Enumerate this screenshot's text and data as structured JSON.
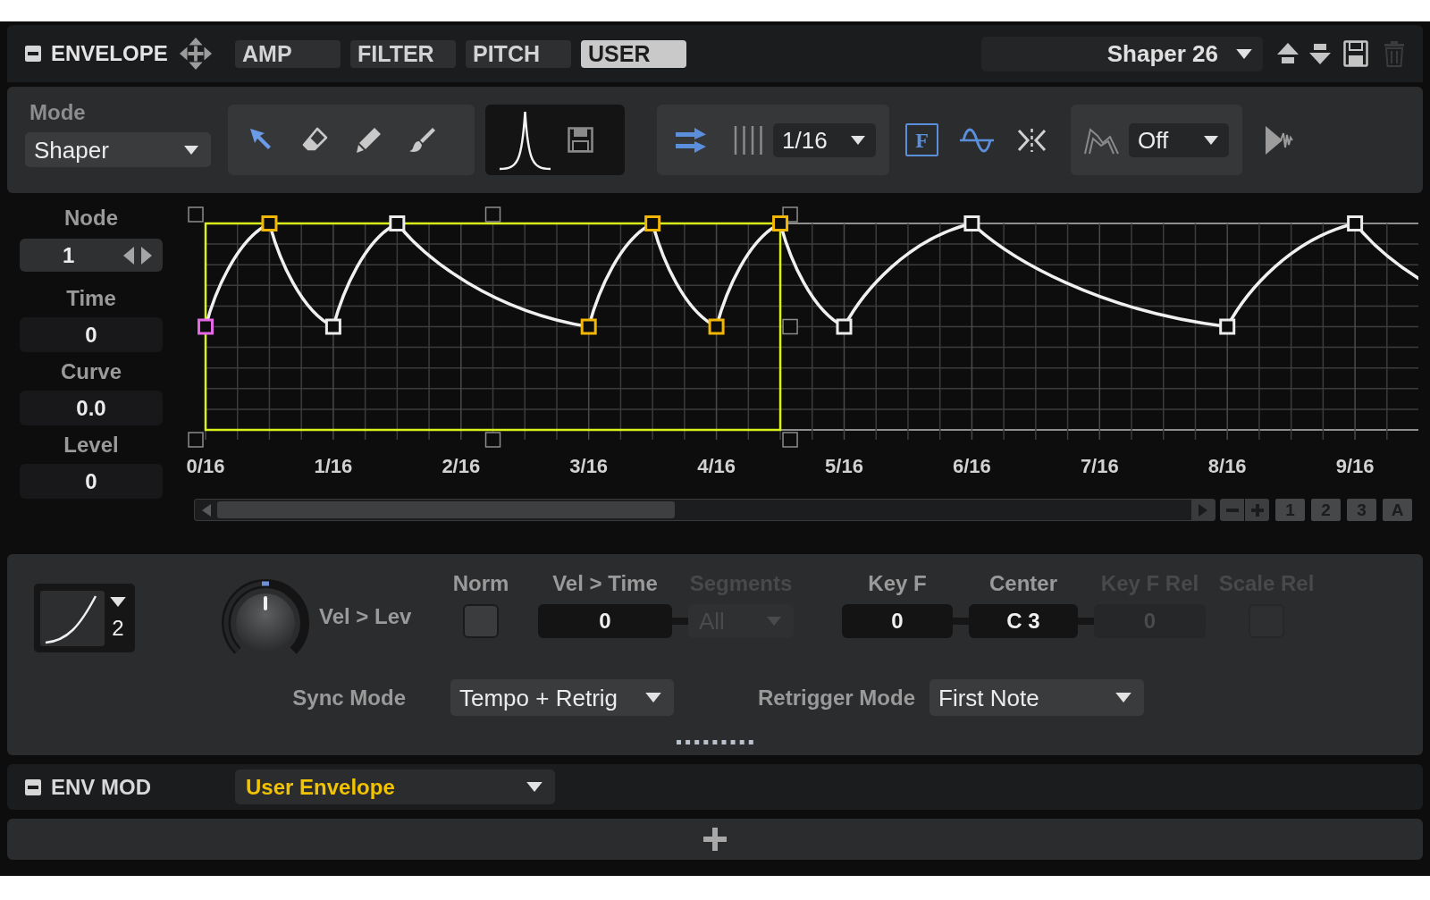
{
  "header": {
    "title": "ENVELOPE",
    "tabs": [
      {
        "label": "AMP",
        "selected": false
      },
      {
        "label": "FILTER",
        "selected": false
      },
      {
        "label": "PITCH",
        "selected": false
      },
      {
        "label": "USER",
        "selected": true
      }
    ],
    "preset": "Shaper 26",
    "trash_disabled": true
  },
  "toolbar": {
    "mode_label": "Mode",
    "mode": "Shaper",
    "tools": [
      {
        "kind": "select",
        "selected": true
      },
      {
        "kind": "erase",
        "selected": false
      },
      {
        "kind": "draw",
        "selected": false
      },
      {
        "kind": "paint",
        "selected": false
      }
    ],
    "sync_on": true,
    "grid": "1/16",
    "toggles": [
      {
        "kind": "letter",
        "label": "F",
        "on": true
      },
      {
        "kind": "wave",
        "on": true
      },
      {
        "kind": "collapse",
        "on": false
      }
    ],
    "shape": "Off"
  },
  "node_panel": {
    "node_label": "Node",
    "node_value": "1",
    "fields": [
      {
        "label": "Time",
        "value": "0"
      },
      {
        "label": "Curve",
        "value": "0.0"
      },
      {
        "label": "Level",
        "value": "0"
      }
    ]
  },
  "envelope": {
    "x_labels": [
      "0/16",
      "1/16",
      "2/16",
      "3/16",
      "4/16",
      "5/16",
      "6/16",
      "7/16",
      "8/16",
      "9/16"
    ],
    "nodes": [
      {
        "focused": true,
        "selected": true
      },
      {
        "focused": false,
        "selected": true
      },
      {
        "focused": false,
        "selected": false
      },
      {
        "focused": false,
        "selected": false
      },
      {
        "focused": false,
        "selected": true
      },
      {
        "focused": false,
        "selected": true
      },
      {
        "focused": false,
        "selected": true
      },
      {
        "focused": false,
        "selected": true
      },
      {
        "focused": false,
        "selected": false
      },
      {
        "focused": false,
        "selected": false
      },
      {
        "focused": false,
        "selected": false
      },
      {
        "focused": false,
        "selected": false
      }
    ],
    "zoom_buttons": [
      "1",
      "2",
      "3",
      "A"
    ]
  },
  "settings": {
    "curve_preset": "2",
    "knob": {
      "label": "Vel > Lev",
      "level": 0.5
    },
    "columns": [
      {
        "kind": "checkbox",
        "label": "Norm",
        "checked": false,
        "disabled": false
      },
      {
        "kind": "field",
        "label": "Vel > Time",
        "value": "0",
        "disabled": false
      },
      {
        "kind": "dropdown",
        "label": "Segments",
        "value": "All",
        "disabled": true
      },
      {
        "kind": "field",
        "label": "Key F",
        "value": "0",
        "disabled": false
      },
      {
        "kind": "field",
        "label": "Center",
        "value": "C 3",
        "disabled": false
      },
      {
        "kind": "field",
        "label": "Key F Rel",
        "value": "0",
        "disabled": true
      },
      {
        "kind": "checkbox",
        "label": "Scale Rel",
        "checked": false,
        "disabled": true
      }
    ],
    "sync_mode": {
      "label": "Sync Mode",
      "value": "Tempo + Retrig"
    },
    "retrigger_mode": {
      "label": "Retrigger Mode",
      "value": "First Note"
    }
  },
  "env_mod": {
    "title": "ENV MOD",
    "source": "User Envelope"
  }
}
